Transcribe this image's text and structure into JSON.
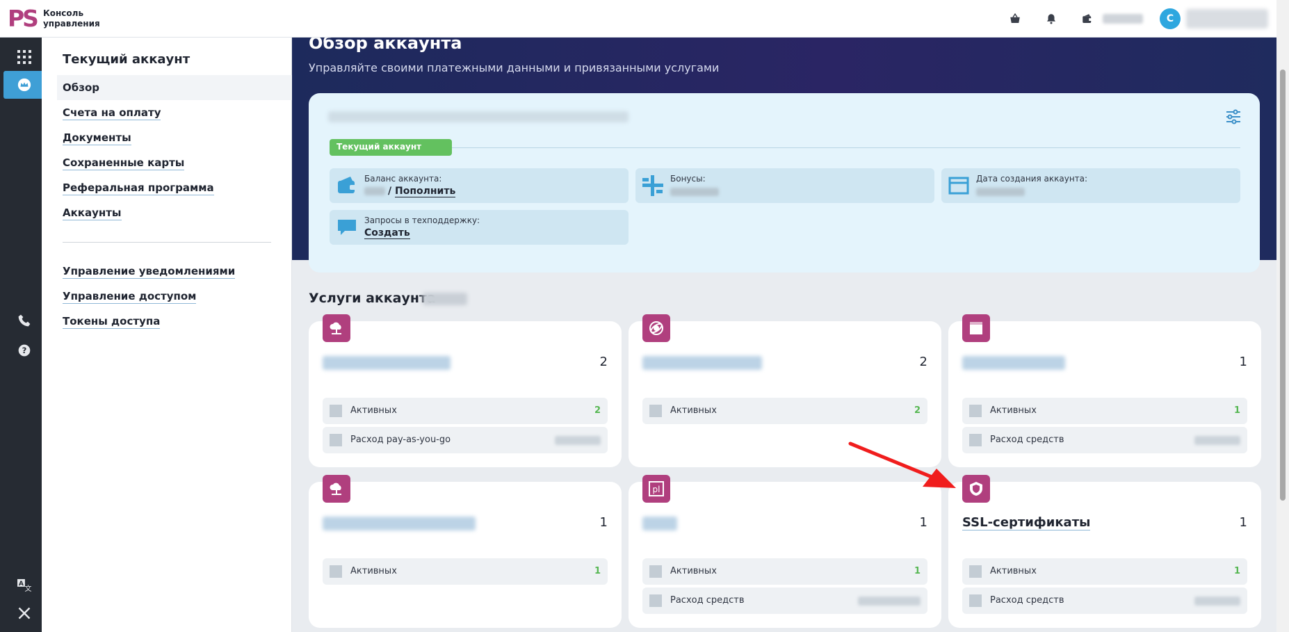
{
  "header": {
    "logo_mark": "PS",
    "logo_text_1": "Консоль",
    "logo_text_2": "управления",
    "avatar_letter": "С"
  },
  "sidebar": {
    "title": "Текущий аккаунт",
    "active_item": "Обзор",
    "items": [
      "Счета на оплату",
      "Документы",
      "Сохраненные карты",
      "Реферальная программа",
      "Аккаунты"
    ],
    "items_secondary": [
      "Управление уведомлениями",
      "Управление доступом",
      "Токены доступа"
    ]
  },
  "hero": {
    "title": "Обзор аккаунта",
    "subtitle": "Управляйте своими платежными данными и привязанными услугами"
  },
  "account_card": {
    "badge": "Текущий аккаунт",
    "balance_label": "Баланс аккаунта:",
    "balance_sep": "/",
    "balance_link": "Пополнить",
    "bonus_label": "Бонусы:",
    "created_label": "Дата создания аккаунта:",
    "support_label": "Запросы в техподдержку:",
    "support_link": "Создать"
  },
  "services": {
    "title": "Услуги аккаунта",
    "cards": [
      {
        "count": "2",
        "rows": [
          {
            "label": "Активных",
            "value": "2"
          },
          {
            "label": "Расход pay-as-you-go",
            "value": ""
          }
        ]
      },
      {
        "count": "2",
        "rows": [
          {
            "label": "Активных",
            "value": "2"
          }
        ]
      },
      {
        "count": "1",
        "rows": [
          {
            "label": "Активных",
            "value": "1"
          },
          {
            "label": "Расход средств",
            "value": ""
          }
        ]
      },
      {
        "count": "1",
        "rows": [
          {
            "label": "Активных",
            "value": "1"
          }
        ]
      },
      {
        "count": "1",
        "rows": [
          {
            "label": "Активных",
            "value": "1"
          },
          {
            "label": "Расход средств",
            "value": ""
          }
        ]
      },
      {
        "name": "SSL-сертификаты",
        "count": "1",
        "rows": [
          {
            "label": "Активных",
            "value": "1"
          },
          {
            "label": "Расход средств",
            "value": ""
          }
        ]
      }
    ]
  },
  "colors": {
    "brand": "#b03f7e",
    "accent": "#3f9fd6",
    "hero_bg": "#2a2564",
    "success": "#63c15f",
    "arrow": "#f01d1d"
  }
}
